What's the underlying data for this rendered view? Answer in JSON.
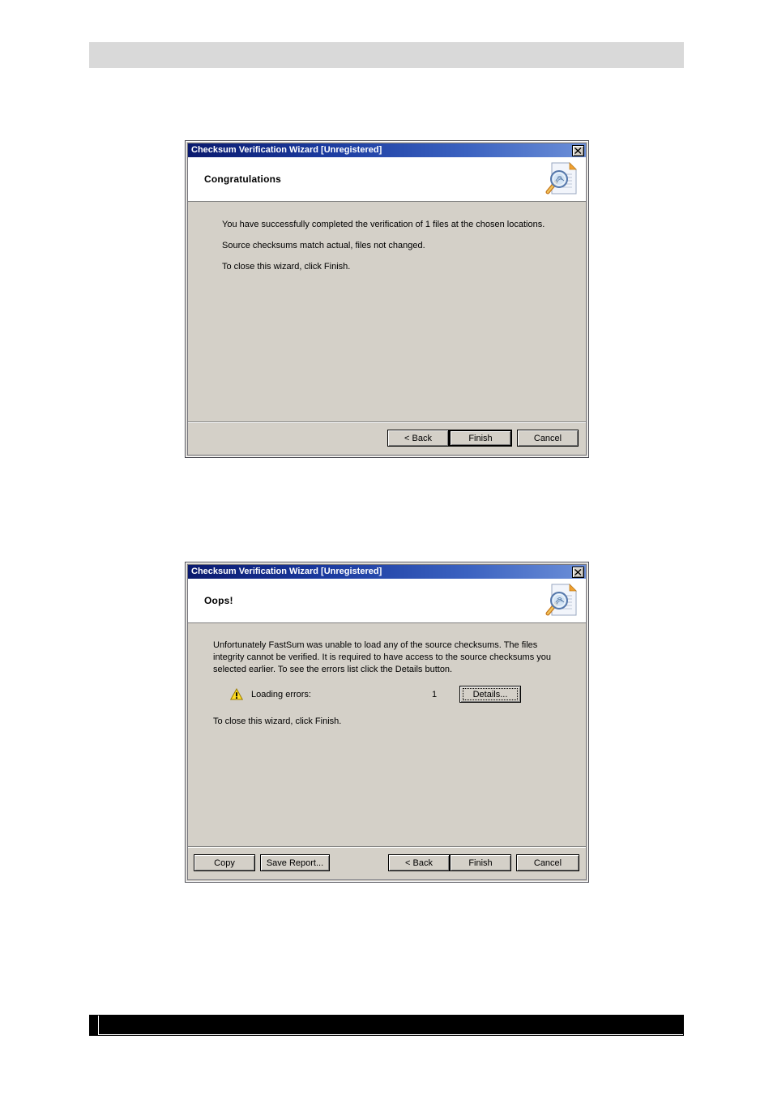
{
  "page": {
    "header_bar_color": "#d9d9d9",
    "footer_bar_color": "#000000"
  },
  "dialogs": [
    {
      "id": "congratulations-dialog",
      "titlebar": {
        "title": "Checksum Verification Wizard [Unregistered]",
        "close_label": "Close",
        "close_icon": "close-x-icon"
      },
      "header": {
        "heading": "Congratulations",
        "icon": "document-magnifier-icon"
      },
      "body": {
        "lines": [
          "You have successfully completed the verification of 1 files at the chosen locations.",
          "Source checksums match actual, files not changed.",
          "To close this wizard, click Finish."
        ]
      },
      "buttons": {
        "back": "< Back",
        "finish": "Finish",
        "cancel": "Cancel"
      }
    },
    {
      "id": "oops-dialog",
      "titlebar": {
        "title": "Checksum Verification Wizard [Unregistered]",
        "close_label": "Close",
        "close_icon": "close-x-icon"
      },
      "header": {
        "heading": "Oops!",
        "icon": "document-magnifier-icon"
      },
      "body": {
        "paragraph": "Unfortunately FastSum was unable to load any of the source checksums. The files integrity cannot be verified. It is required to have access to the source checksums you selected earlier. To see the errors list click the Details button.",
        "error_row": {
          "icon": "warning-triangle-icon",
          "label": "Loading errors:",
          "count": "1",
          "details_button": "Details..."
        },
        "closing_line": "To close this wizard, click Finish."
      },
      "buttons": {
        "copy": "Copy",
        "save_report": "Save Report...",
        "back": "< Back",
        "finish": "Finish",
        "cancel": "Cancel"
      }
    }
  ]
}
